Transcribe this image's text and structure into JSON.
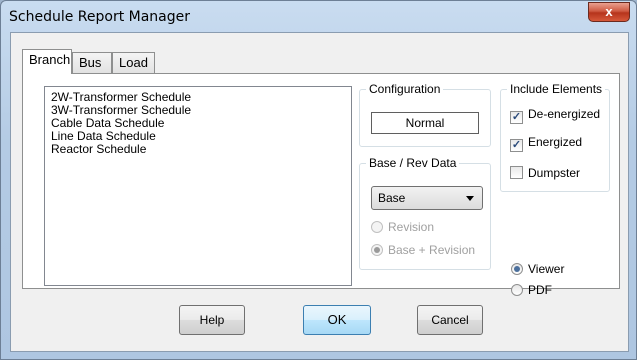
{
  "window": {
    "title": "Schedule Report Manager",
    "close_glyph": "x"
  },
  "tabs": [
    "Branch",
    "Bus",
    "Load"
  ],
  "schedules": [
    "2W-Transformer Schedule",
    "3W-Transformer Schedule",
    "Cable Data Schedule",
    "Line Data Schedule",
    "Reactor Schedule"
  ],
  "configuration": {
    "label": "Configuration",
    "value": "Normal"
  },
  "base_rev": {
    "label": "Base / Rev Data",
    "selected": "Base",
    "options": [
      "Revision",
      "Base + Revision"
    ]
  },
  "include_elements": {
    "label": "Include Elements",
    "items": [
      {
        "label": "De-energized",
        "checked": true
      },
      {
        "label": "Energized",
        "checked": true
      },
      {
        "label": "Dumpster",
        "checked": false
      }
    ]
  },
  "output": {
    "options": [
      "Viewer",
      "PDF"
    ],
    "selected": "Viewer"
  },
  "buttons": {
    "help": "Help",
    "ok": "OK",
    "cancel": "Cancel"
  }
}
